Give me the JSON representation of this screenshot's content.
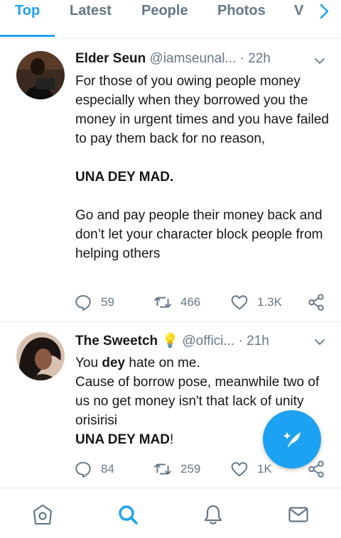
{
  "tabs": [
    {
      "label": "Top",
      "active": true
    },
    {
      "label": "Latest"
    },
    {
      "label": "People"
    },
    {
      "label": "Photos"
    },
    {
      "label": "V"
    }
  ],
  "tweets": [
    {
      "name": "Elder Seun",
      "handle": "@iamseunal...",
      "separator": "·",
      "time": "22h",
      "paragraphs": [
        "For those of you owing people money especially when they borrowed you the money in urgent times and you have failed to pay them back for no reason,",
        "UNA DEY MAD.",
        "Go and pay people their money back and don’t let your character block people from helping others"
      ],
      "counts": {
        "replies": "59",
        "retweets": "466",
        "likes": "1.3K"
      }
    },
    {
      "name": "The Sweetch",
      "name_emoji": "💡",
      "handle": "@offici...",
      "separator": "·",
      "time": "21h",
      "lines": {
        "you": "You ",
        "dey": "dey",
        "hate": " hate on me.",
        "line2": "Cause of borrow pose, meanwhile two of us no get money isn't that lack of unity orisirisi",
        "una_dey_mad": "UNA DEY MAD",
        "bang": "!"
      },
      "counts": {
        "replies": "84",
        "retweets": "259",
        "likes": "1K"
      }
    }
  ],
  "colors": {
    "accent": "#1da1f2",
    "text": "#14171a",
    "muted": "#657786"
  },
  "icons": {
    "tab_next": "chevron-right-icon",
    "caret": "chevron-down-icon",
    "reply": "reply-icon",
    "retweet": "retweet-icon",
    "like": "heart-icon",
    "share": "share-icon",
    "compose": "compose-tweet-icon",
    "nav": [
      "home-icon",
      "search-icon",
      "notifications-icon",
      "messages-icon"
    ]
  }
}
